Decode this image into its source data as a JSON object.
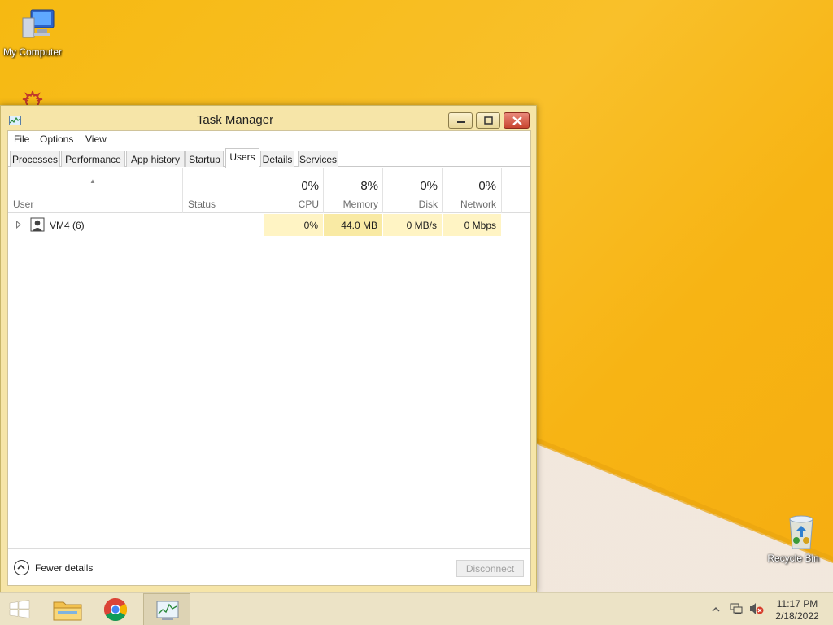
{
  "desktop": {
    "icons": [
      {
        "label": "My Computer"
      },
      {
        "label": "Recycle Bin"
      }
    ]
  },
  "window": {
    "title": "Task Manager",
    "menu": [
      "File",
      "Options",
      "View"
    ],
    "tabs": [
      "Processes",
      "Performance",
      "App history",
      "Startup",
      "Users",
      "Details",
      "Services"
    ],
    "active_tab": "Users",
    "columns": {
      "user": "User",
      "status": "Status",
      "cpu": {
        "pct": "0%",
        "label": "CPU"
      },
      "memory": {
        "pct": "8%",
        "label": "Memory"
      },
      "disk": {
        "pct": "0%",
        "label": "Disk"
      },
      "network": {
        "pct": "0%",
        "label": "Network"
      }
    },
    "rows": [
      {
        "user": "VM4 (6)",
        "status": "",
        "cpu": "0%",
        "memory": "44.0 MB",
        "disk": "0 MB/s",
        "network": "0 Mbps"
      }
    ],
    "footer": {
      "fewer_details": "Fewer details",
      "disconnect": "Disconnect"
    }
  },
  "taskbar": {
    "clock_time": "11:17 PM",
    "clock_date": "2/18/2022"
  }
}
